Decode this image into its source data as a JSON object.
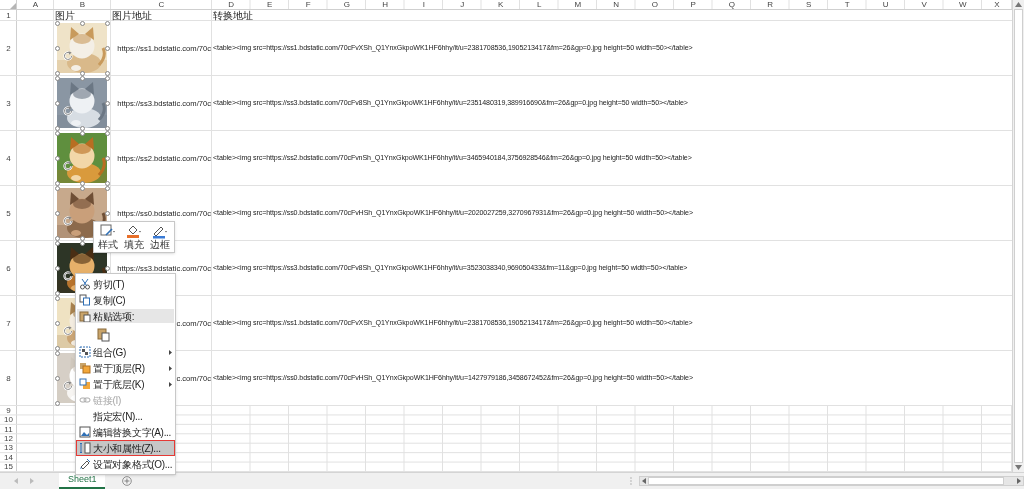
{
  "column_headers": [
    "A",
    "B",
    "C",
    "D",
    "E",
    "F",
    "G",
    "H",
    "I",
    "J",
    "K",
    "L",
    "M",
    "N",
    "O",
    "P",
    "Q",
    "R",
    "S",
    "T",
    "U",
    "V",
    "W",
    "X"
  ],
  "row_headers": [
    "1",
    "2",
    "3",
    "4",
    "5",
    "6",
    "7",
    "8",
    "9",
    "10",
    "11",
    "12",
    "13",
    "14",
    "15"
  ],
  "header_row": [
    "图片",
    "图片地址",
    "转换地址"
  ],
  "rows": [
    {
      "image": {
        "selected": true
      },
      "url": "https://ss1.bdstatic.com/70c",
      "converted": "<table><img src=https://ss1.bdstatic.com/70cFvXSh_Q1YnxGkpoWK1HF6hhy/it/u=2381708536,1905213417&fm=26&gp=0.jpg height=50 width=50></table>"
    },
    {
      "image": {
        "selected": true
      },
      "url": "https://ss3.bdstatic.com/70c",
      "converted": "<table><img src=https://ss3.bdstatic.com/70cFv8Sh_Q1YnxGkpoWK1HF6hhy/it/u=2351480319,389916690&fm=26&gp=0.jpg height=50 width=50></table>"
    },
    {
      "image": {
        "selected": true
      },
      "url": "https://ss2.bdstatic.com/70c",
      "converted": "<table><img src=https://ss2.bdstatic.com/70cFvnSh_Q1YnxGkpoWK1HF6hhy/it/u=3465940184,3756928546&fm=26&gp=0.jpg height=50 width=50></table>"
    },
    {
      "image": {
        "selected": true
      },
      "url": "https://ss0.bdstatic.com/70c",
      "converted": "<table><img src=https://ss0.bdstatic.com/70cFvHSh_Q1YnxGkpoWK1HF6hhy/it/u=2020027259,3270967931&fm=26&gp=0.jpg height=50 width=50></table>"
    },
    {
      "image": {
        "selected": true
      },
      "url": "https://ss3.bdstatic.com/70c",
      "converted": "<table><img src=https://ss3.bdstatic.com/70cFv8Sh_Q1YnxGkpoWK1HF6hhy/it/u=3523038340,969050433&fm=11&gp=0.jpg height=50 width=50></table>"
    },
    {
      "image": {
        "selected": true
      },
      "url": "c.com/70c",
      "converted": "<table><img src=https://ss1.bdstatic.com/70cFvXSh_Q1YnxGkpoWK1HF6hhy/it/u=2381708536,1905213417&fm=26&gp=0.jpg height=50 width=50></table>"
    },
    {
      "image": {
        "selected": true
      },
      "url": "c.com/70c",
      "converted": "<table><img src=https://ss0.bdstatic.com/70cFvHSh_Q1YnxGkpoWK1HF6hhy/it/u=1427979186,3458672452&fm=26&gp=0.jpg height=50 width=50></table>"
    }
  ],
  "mini_toolbar": [
    {
      "label": "样式"
    },
    {
      "label": "填充"
    },
    {
      "label": "边框"
    }
  ],
  "context_menu": [
    {
      "kind": "command",
      "label": "剪切(T)",
      "submenu": false,
      "disabled": false,
      "selected": false,
      "outlined": false
    },
    {
      "kind": "command",
      "label": "复制(C)",
      "submenu": false,
      "disabled": false,
      "selected": false,
      "outlined": false
    },
    {
      "kind": "header",
      "label": "粘贴选项:",
      "submenu": false,
      "disabled": false,
      "selected": false,
      "outlined": false
    },
    {
      "kind": "paste-option",
      "disabled": false,
      "selected": false
    },
    {
      "kind": "command",
      "label": "组合(G)",
      "submenu": true,
      "disabled": false,
      "selected": false,
      "outlined": false
    },
    {
      "kind": "command",
      "label": "置于顶层(R)",
      "submenu": true,
      "disabled": false,
      "selected": false,
      "outlined": false
    },
    {
      "kind": "command",
      "label": "置于底层(K)",
      "submenu": true,
      "disabled": false,
      "selected": false,
      "outlined": false
    },
    {
      "kind": "command",
      "label": "链接(I)",
      "submenu": false,
      "disabled": true,
      "selected": false,
      "outlined": false
    },
    {
      "kind": "command",
      "label": "指定宏(N)...",
      "submenu": false,
      "disabled": false,
      "selected": false,
      "outlined": false
    },
    {
      "kind": "command",
      "label": "编辑替换文字(A)...",
      "submenu": false,
      "disabled": false,
      "selected": false,
      "outlined": false
    },
    {
      "kind": "command",
      "label": "大小和属性(Z)...",
      "submenu": false,
      "disabled": false,
      "selected": true,
      "outlined": true
    },
    {
      "kind": "command",
      "label": "设置对象格式(O)...",
      "submenu": false,
      "disabled": false,
      "selected": false,
      "outlined": false
    }
  ],
  "sheet_tabs": [
    {
      "label": "Sheet1",
      "selected": true
    }
  ]
}
